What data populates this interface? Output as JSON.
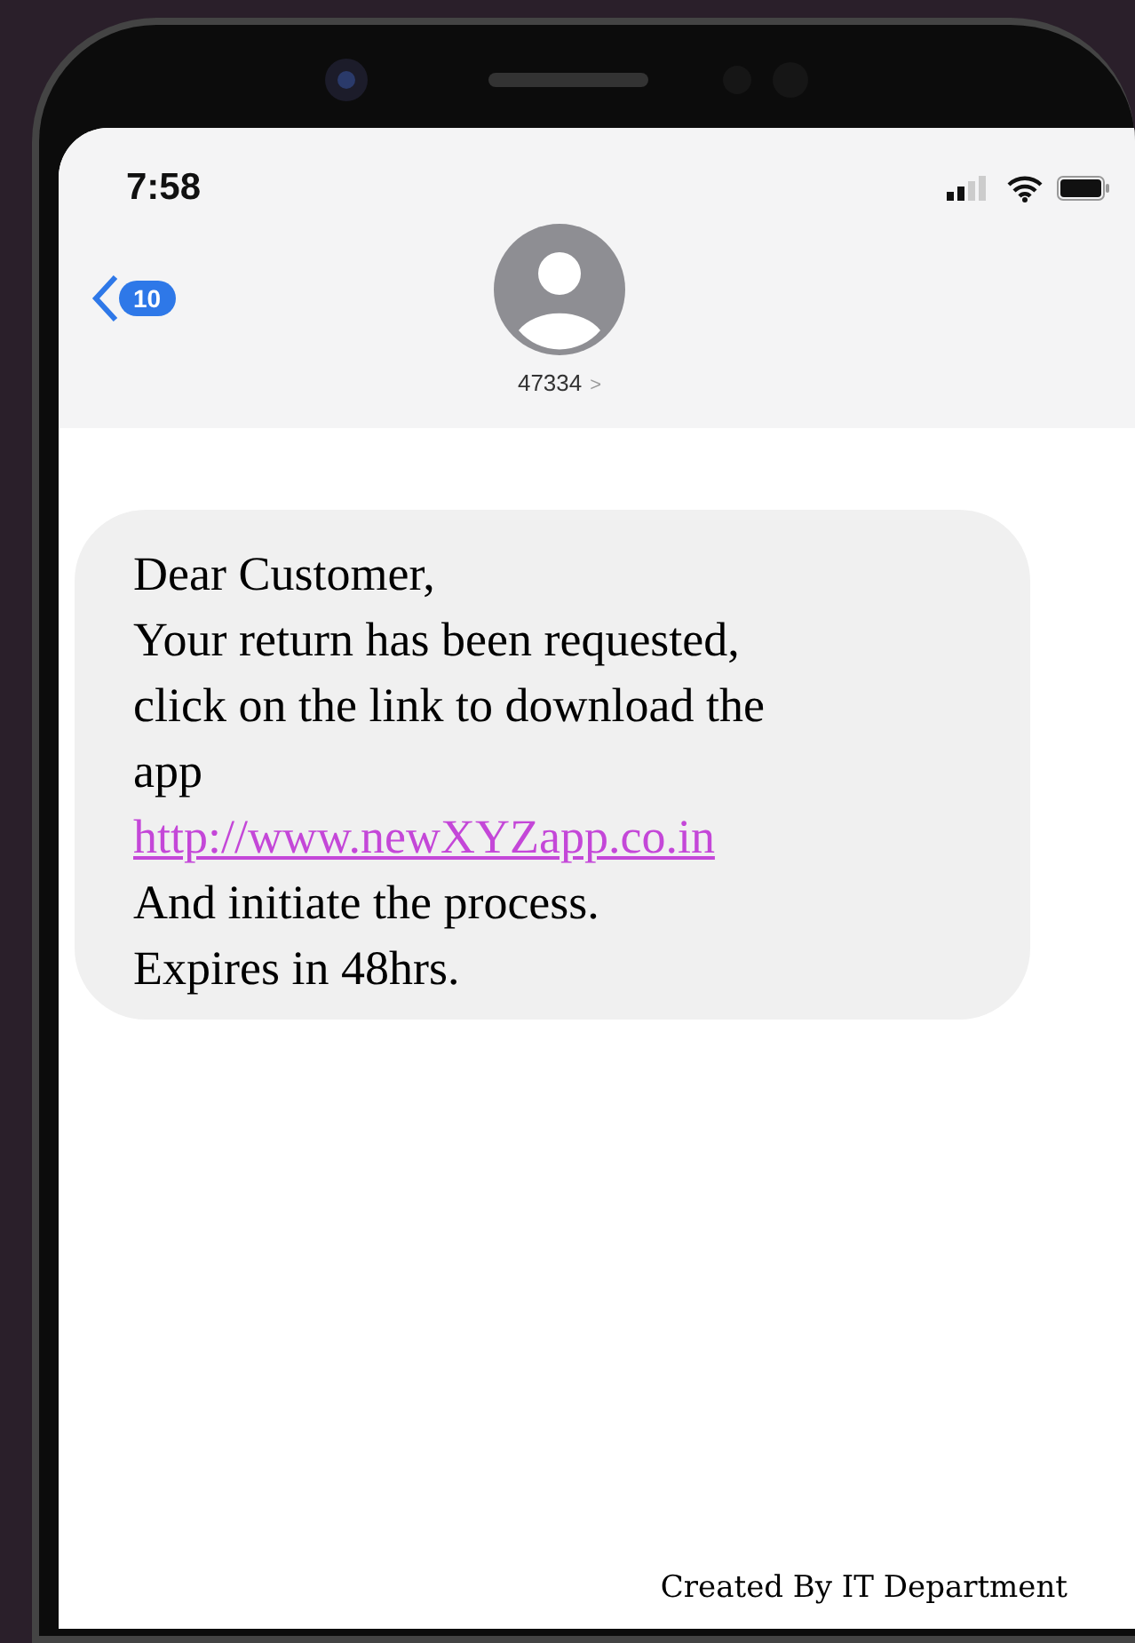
{
  "status_bar": {
    "time": "7:58"
  },
  "header": {
    "back_count": "10",
    "contact": "47334",
    "contact_chevron": ">"
  },
  "message": {
    "lines": [
      {
        "kind": "text",
        "text": "Dear Customer,"
      },
      {
        "kind": "text",
        "text": "Your return has been requested,"
      },
      {
        "kind": "text",
        "text": "click on the link to download the"
      },
      {
        "kind": "text",
        "text": "app"
      },
      {
        "kind": "link",
        "text": "http://www.newXYZapp.co.in"
      },
      {
        "kind": "text",
        "text": "And initiate the process."
      },
      {
        "kind": "text",
        "text": "Expires in 48hrs."
      }
    ]
  },
  "footer": "Created By IT Department"
}
